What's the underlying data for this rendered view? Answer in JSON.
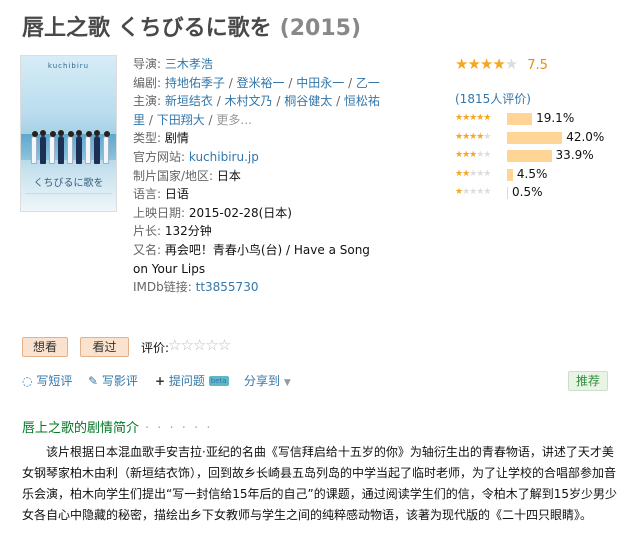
{
  "title": {
    "name": "唇上之歌 くちびるに歌を",
    "year": "(2015)"
  },
  "poster": {
    "top_text": "kuchibiru",
    "title": "くちびるに歌を"
  },
  "info": {
    "director_label": "导演: ",
    "director": "三木孝浩",
    "writer_label": "编剧: ",
    "writers": [
      "持地佑季子",
      "登米裕一",
      "中田永一",
      "乙一"
    ],
    "cast_label": "主演: ",
    "cast": [
      "新垣结衣",
      "木村文乃",
      "桐谷健太",
      "恒松祐里",
      "下田翔大"
    ],
    "more": "更多...",
    "genre_label": "类型: ",
    "genre": "剧情",
    "site_label": "官方网站: ",
    "site": "kuchibiru.jp",
    "country_label": "制片国家/地区: ",
    "country": "日本",
    "lang_label": "语言: ",
    "lang": "日语",
    "release_label": "上映日期: ",
    "release": "2015-02-28(日本)",
    "runtime_label": "片长: ",
    "runtime": "132分钟",
    "aka_label": "又名: ",
    "aka": "再会吧！青春小鸟(台) / Have a Song on Your Lips",
    "imdb_label": "IMDb链接: ",
    "imdb": "tt3855730"
  },
  "rating": {
    "score": "7.5",
    "stars": 4,
    "votes": "(1815人评价)",
    "distribution": [
      {
        "stars": 5,
        "pct": "19.1%",
        "value": 19.1
      },
      {
        "stars": 4,
        "pct": "42.0%",
        "value": 42.0
      },
      {
        "stars": 3,
        "pct": "33.9%",
        "value": 33.9
      },
      {
        "stars": 2,
        "pct": "4.5%",
        "value": 4.5
      },
      {
        "stars": 1,
        "pct": "0.5%",
        "value": 0.5
      }
    ]
  },
  "buttons": {
    "want": "想看",
    "seen": "看过",
    "rate_label": "评价:"
  },
  "actions": {
    "short_review": "写短评",
    "review": "写影评",
    "ask": "提问题",
    "beta": "beta",
    "share": "分享到",
    "recommend": "推荐"
  },
  "section": {
    "title": "唇上之歌的剧情简介",
    "dots": "· · · · · ·"
  },
  "summary": "该片根据日本混血歌手安吉拉·亚纪的名曲《写信拜启给十五岁的你》为轴衍生出的青春物语，讲述了天才美女钢琴家柏木由利（新垣结衣饰），回到故乡长崎县五岛列岛的中学当起了临时老师，为了让学校的合唱部参加音乐会演，柏木向学生们提出“写一封信给15年后的自己”的课题，通过阅读学生们的信，令柏木了解到15岁少男少女各自心中隐藏的秘密，描绘出乡下女教师与学生之间的纯粹感动物语，该著为现代版的《二十四只眼睛》。",
  "colors": {
    "link": "#3377aa",
    "star": "#f5a623",
    "bar": "#ffd596",
    "green": "#007722"
  }
}
